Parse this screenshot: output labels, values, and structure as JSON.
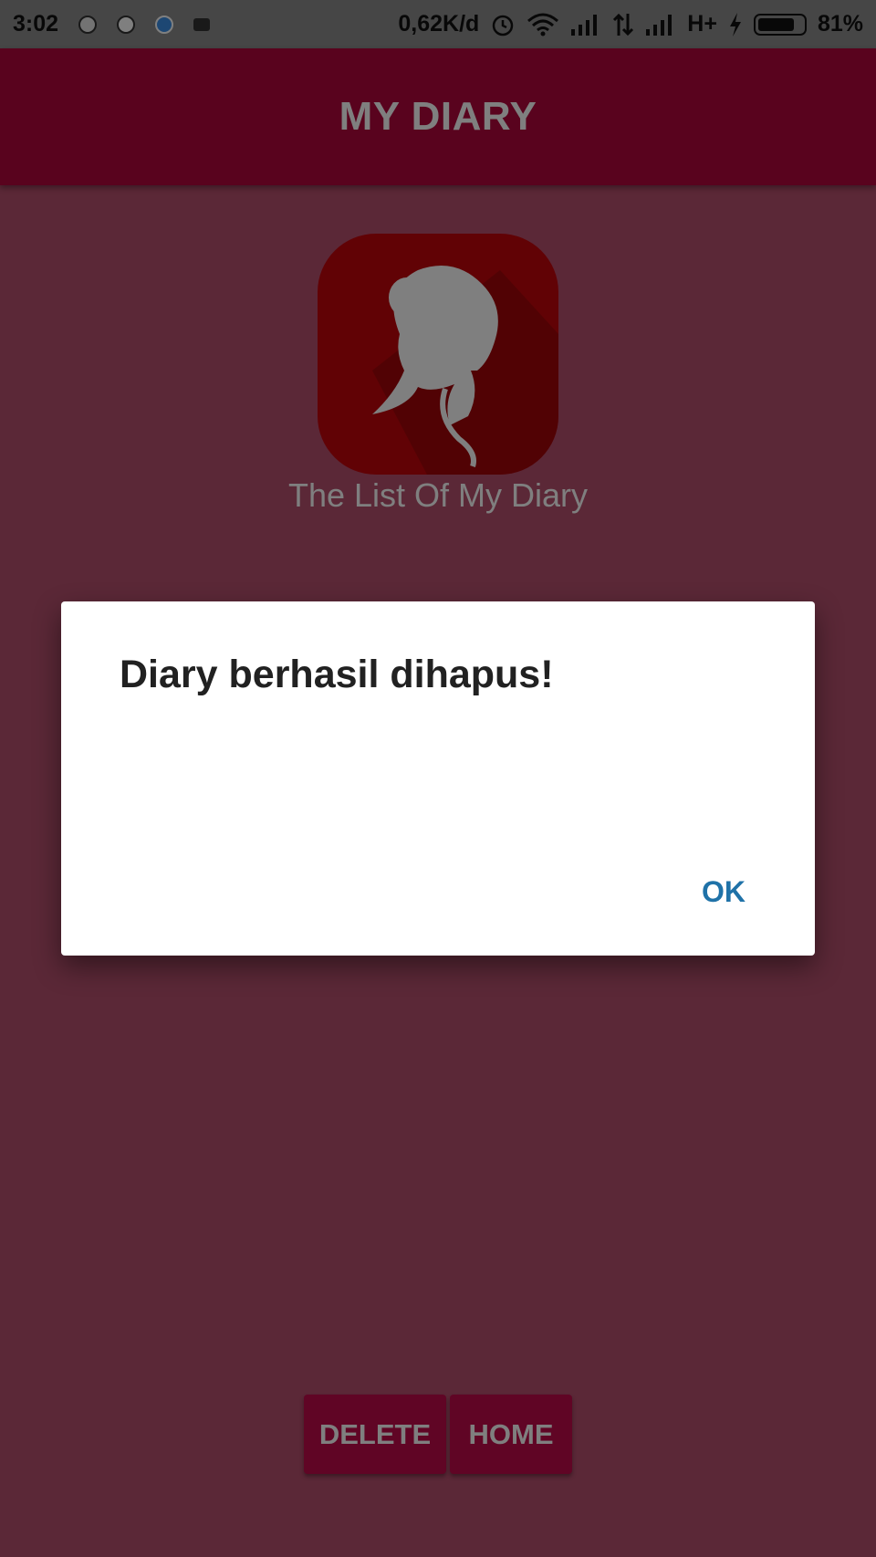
{
  "status_bar": {
    "time": "3:02",
    "speed": "0,62K/d",
    "network": "H+",
    "battery": "81%",
    "battery_level": 0.81,
    "icons": [
      "notification-app-icon",
      "notification-up-icon",
      "notification-circle-icon",
      "notification-bug-icon",
      "alarm-icon",
      "wifi-icon",
      "signal-icon",
      "data-arrows-icon",
      "signal-icon",
      "charging-icon",
      "battery-icon"
    ]
  },
  "app_bar": {
    "title": "MY DIARY"
  },
  "main": {
    "logo": "woman-silhouette-logo",
    "subtitle": "The List Of My Diary"
  },
  "buttons": {
    "delete_label": "DELETE",
    "home_label": "HOME"
  },
  "dialog": {
    "message": "Diary berhasil dihapus!",
    "ok_label": "OK"
  },
  "colors": {
    "app_bar": "#b3063d",
    "background": "#b6506e",
    "button": "#c00a4a",
    "logo_background": "#c2050a",
    "dialog_accent": "#1f72a8"
  }
}
